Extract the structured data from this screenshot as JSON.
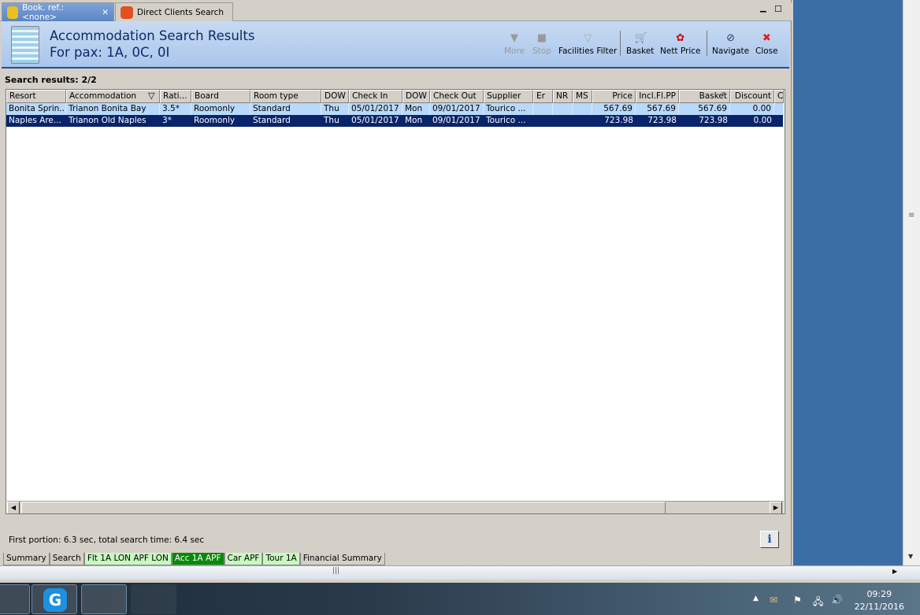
{
  "tabs": [
    {
      "label": "Book. ref.: <none>",
      "icon": "palm-tree-icon",
      "closable": true
    },
    {
      "label": "Direct Clients Search",
      "icon": "clients-icon"
    }
  ],
  "header": {
    "title": "Accommodation Search Results",
    "subtitle": "For pax: 1A, 0C, 0I"
  },
  "toolbar": [
    {
      "label": "More",
      "icon": "more-icon",
      "enabled": false
    },
    {
      "label": "Stop",
      "icon": "stop-icon",
      "enabled": false
    },
    {
      "label": "Facilities Filter",
      "icon": "filter-icon"
    },
    {
      "label": "Basket",
      "icon": "basket-icon"
    },
    {
      "label": "Nett Price",
      "icon": "nett-price-icon"
    },
    {
      "label": "Navigate",
      "icon": "compass-icon"
    },
    {
      "label": "Close",
      "icon": "close-icon"
    }
  ],
  "results_label": "Search results: 2/2",
  "columns": [
    "Resort",
    "Accommodation",
    "Rati...",
    "Board",
    "Room type",
    "DOW",
    "Check In",
    "DOW",
    "Check Out",
    "Supplier",
    "Er",
    "NR",
    "MS",
    "Price",
    "Incl.Fl.PP",
    "Basket",
    "Discount",
    "C"
  ],
  "rows": [
    [
      "Bonita Sprin...",
      "Trianon Bonita Bay",
      "3.5*",
      "Roomonly",
      "Standard",
      "Thu",
      "05/01/2017",
      "Mon",
      "09/01/2017",
      "Tourico ...",
      "",
      "",
      "",
      "567.69",
      "567.69",
      "567.69",
      "0.00",
      ""
    ],
    [
      "Naples Are...",
      "Trianon Old Naples",
      "3*",
      "Roomonly",
      "Standard",
      "Thu",
      "05/01/2017",
      "Mon",
      "09/01/2017",
      "Tourico ...",
      "",
      "",
      "",
      "723.98",
      "723.98",
      "723.98",
      "0.00",
      ""
    ]
  ],
  "status": "First portion: 6.3 sec, total search time: 6.4 sec",
  "info_label": "i",
  "bottom_tabs": [
    "Summary",
    "Search",
    "Flt 1A LON APF LON",
    "Acc 1A APF",
    "Car APF",
    "Tour 1A",
    "Financial Summary"
  ],
  "clock": {
    "time": "09:29",
    "date": "22/11/2016"
  },
  "colors": {
    "selected_row": "#0a246a",
    "highlight_row": "#b9d9fb",
    "active_tab": "#0a8a0a"
  }
}
